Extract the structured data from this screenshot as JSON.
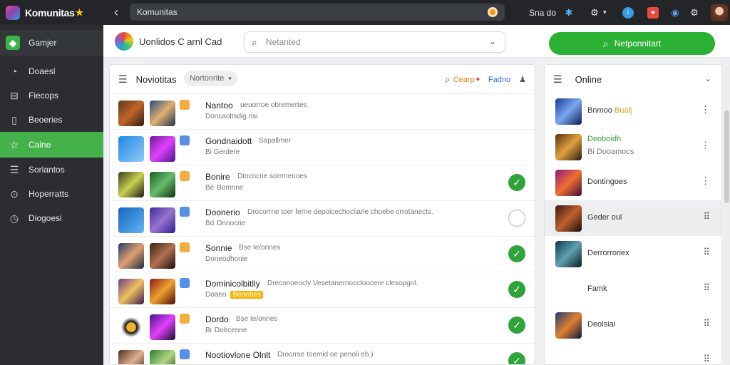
{
  "app": {
    "name": "Komunitas"
  },
  "topbar": {
    "back_label": "‹",
    "address": "Komunitas",
    "user_label": "Sna do"
  },
  "sidebar": {
    "items": [
      {
        "label": "Gamjer",
        "icon": "game-icon"
      },
      {
        "label": "Doaesl",
        "icon": "chart-icon"
      },
      {
        "label": "Fiecops",
        "icon": "bookmark-icon"
      },
      {
        "label": "Beoeries",
        "icon": "book-icon"
      },
      {
        "label": "Caine",
        "icon": "star-icon"
      },
      {
        "label": "Sorlantos",
        "icon": "list-icon"
      },
      {
        "label": "Hoperratts",
        "icon": "settings-icon"
      },
      {
        "label": "Diogoesi",
        "icon": "clock-icon"
      }
    ]
  },
  "header": {
    "title": "Uonlidos C arnl Cad",
    "search_placeholder": "Netanted",
    "cta_label": "Netponnitart"
  },
  "panel": {
    "title": "Noviotitas",
    "filter": "Nortonrite",
    "tool_label": "Cearp",
    "tool_label2": "Fadno",
    "rows": [
      {
        "name": "Nantoo",
        "desc": "ueuorroe obremertes",
        "sub": "Doncaoltsdig risi",
        "checked": null
      },
      {
        "name": "Gondnaidott",
        "desc": "Sapallmer",
        "sub": "Bi Gerdere",
        "checked": null
      },
      {
        "name": "Bonire",
        "desc": "Dtococrie sorrmenoes",
        "sub": "Bomnne",
        "sub_prefix": "Bé",
        "checked": true
      },
      {
        "name": "Doonerio",
        "desc": "Drocorrne toer ferne depoicechocliarie choebe crrotanects.",
        "sub": "Dnnocrie",
        "sub_prefix": "Bd",
        "checked": false
      },
      {
        "name": "Sonnie",
        "desc": "Bse te/onnes",
        "sub": "Doneodhonie",
        "checked": true
      },
      {
        "name": "Dominicolbitlly",
        "desc": "Dreconoeocly Vesetanernocctoocere clesopgol.",
        "sub": "Doaeo",
        "sub_tag": "Beoebes",
        "checked": true
      },
      {
        "name": "Dordo",
        "desc": "Bse te/onnes",
        "sub": "Dolrcenne",
        "sub_prefix": "Bi",
        "checked": true
      },
      {
        "name": "Nootiovlone Olnlt",
        "desc": "Drocrrse toemid oe penoli eb.)",
        "sub": "",
        "checked": true
      }
    ]
  },
  "online": {
    "title": "Online",
    "items": [
      {
        "name": "Bnmoo",
        "tag": "Bualj",
        "menu": "⋮"
      },
      {
        "name": "Deoboidh",
        "sub": "Bi Dooamocs",
        "menu": "⋮"
      },
      {
        "name": "Dontingoes",
        "menu": "⋮"
      },
      {
        "name": "Geder oul",
        "menu": "⠿"
      },
      {
        "name": "Derrorroriex",
        "menu": "⠿"
      },
      {
        "name": "Famk",
        "menu": "⠿"
      },
      {
        "name": "Deolsiai",
        "menu": "⠿"
      },
      {
        "name": "",
        "menu": "⠿"
      }
    ]
  },
  "colors": {
    "accent": "#2db135",
    "sidebar": "#2b2d30",
    "topbar": "#232528",
    "check": "#2ea43b"
  }
}
